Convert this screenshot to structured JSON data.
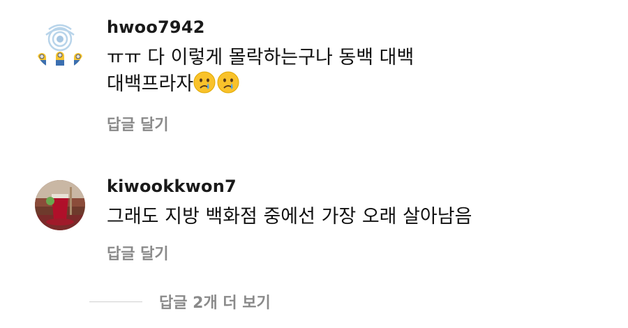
{
  "comments": [
    {
      "username": "hwoo7942",
      "text_line1": "ㅠㅠ 다 이렇게 몰락하는구나 동백 대백",
      "text_line2": "대백프라자",
      "emojis": [
        "crying-face",
        "crying-face"
      ],
      "reply_label": "답글 달기",
      "avatar": "minions-cartoon-avatar"
    },
    {
      "username": "kiwookkwon7",
      "text_line1": "그래도 지방 백화점 중에선 가장 오래 살아남음",
      "reply_label": "답글 달기",
      "avatar": "red-drink-photo-avatar"
    }
  ],
  "more_replies_label": "답글 2개 더 보기",
  "colors": {
    "text": "#111111",
    "secondary": "#8a8a8a",
    "divider": "#d0d0d0"
  }
}
